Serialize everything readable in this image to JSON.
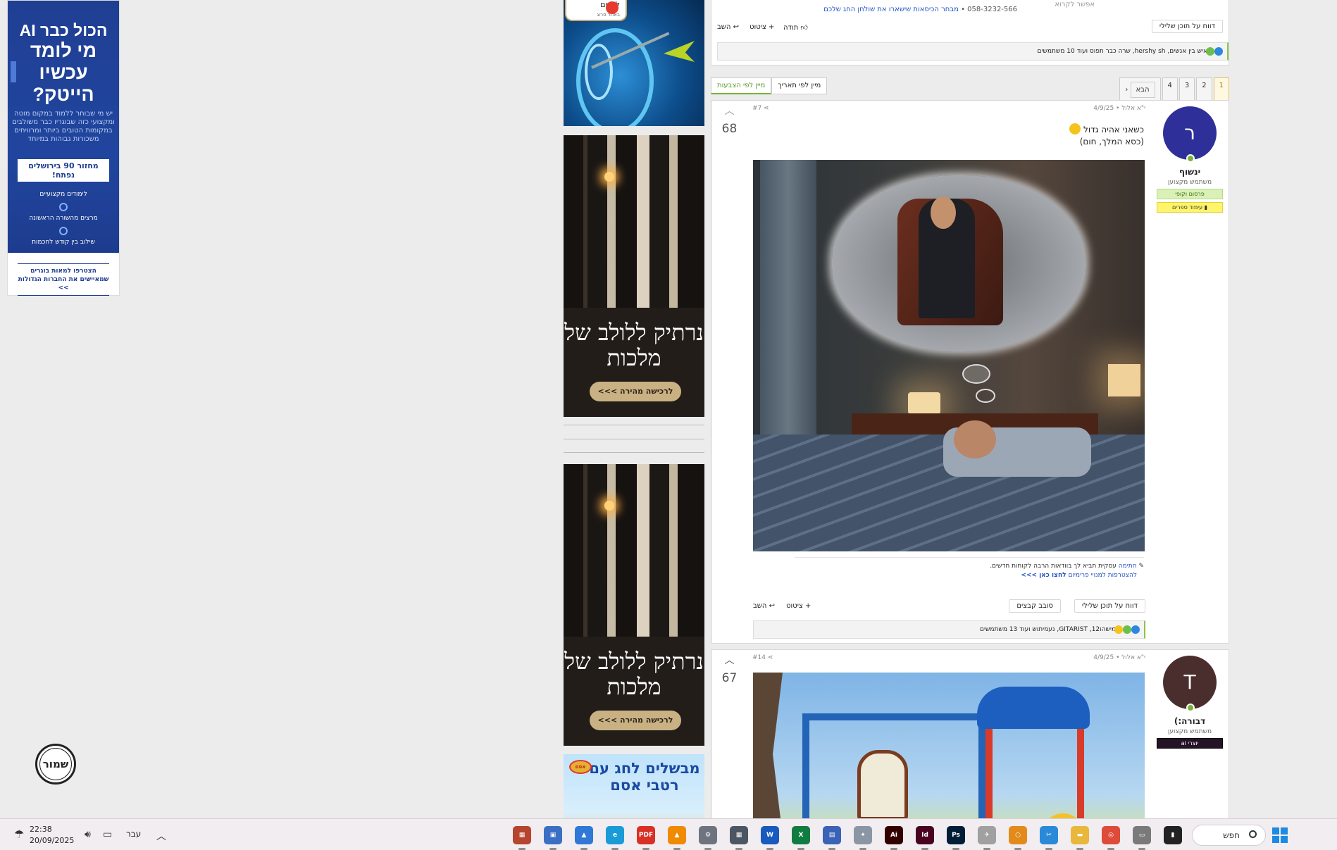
{
  "left_ad": {
    "headline1": "הכול כבר AI",
    "headline2": "מי לומד עכשיו הייטק?",
    "body": "יש מי שבוחר ללמוד במקום מוטה ומקצועי כזה שבוגריו כבר משולבים במקומות הטובים ביותר ומרוויחים משכורות גבוהות במיוחד",
    "cta": "מחזור 90 בירושלים נפתח!",
    "features": [
      "לימודים מקצועיים",
      "מרצים מהשורה הראשונה",
      "שילוב בין קודש לחכמות"
    ],
    "bottom_line1": "הצטרפו למאות בוגרים",
    "bottom_line2": "שמאיישים את החברות הגדולות >>",
    "accent": "#1f3f93"
  },
  "stamp_logo": {
    "text": "שמור"
  },
  "mid_ads": {
    "top_badge_title": "לחגים",
    "top_badge_sub": "באתר פרוג",
    "book_title": "נרתיק ללולב של מלכות",
    "book_button": "לרכישה מהירה >>>",
    "food_title": "מבשלים לחג עם רטבי אסם",
    "food_brand": "אסם"
  },
  "prev_post": {
    "sig_top": "אפשר לקרוא",
    "sig_phone": "058-3232-566 •",
    "sig_link": "מבחר הכיסאות שישארו את שולחן החג שלכם",
    "report_btn": "דווח על תוכן שלילי",
    "like_label": "תודה",
    "quote_label": "ציטוט",
    "reply_label": "השב",
    "reactions_text": "איש בין אנשים, hershy sh, שרה כבר תפוס ועוד 10 משתמשים"
  },
  "pager": {
    "pages": [
      "1",
      "2",
      "3",
      "4"
    ],
    "current": "1",
    "next_label": "הבא"
  },
  "sort": {
    "by_date": "מיין לפי תאריך",
    "by_votes": "מיין לפי הצבעות",
    "active": "by_votes"
  },
  "post7": {
    "number": "#7",
    "date": "י\"א אלול • 4/9/25",
    "username": "ינשוף",
    "avatar_letter": "ר",
    "avatar_color": "#2f2f9a",
    "role": "משתמש מקצוען",
    "badge1": "פרסום וקופי",
    "badge2": "עימוד ספרים",
    "score": "68",
    "line1": "כשאני אהיה גדול",
    "line2": "(כסא המלך, חום)",
    "sig_prefix": "חתימה",
    "sig_text": "עסקית תביא לך בוודאות הרבה לקוחות חדשים.",
    "sig_line2": "להצטרפות למנויי פרימיום",
    "sig_link": "לחצו כאן >>>",
    "report_btn": "דווח על תוכן שלילי",
    "files_btn": "סובב קבצים",
    "quote_label": "ציטוט",
    "reply_label": "השב",
    "reactions_text": "מישהו12, GITARIST, נעמיתוש ועוד 13 משתמשים"
  },
  "post14": {
    "number": "#14",
    "date": "י\"א אלול • 4/9/25",
    "username": "דבורה:)",
    "avatar_letter": "T",
    "avatar_color": "#4a2e2e",
    "role": "משתמש מקצוען",
    "badge1": "יוצרי ai",
    "score": "67"
  },
  "taskbar": {
    "search_label": "חפש",
    "time": "22:38",
    "date": "20/09/2025",
    "lang": "עבר",
    "apps": [
      {
        "name": "winrar-icon",
        "color": "#b5452f",
        "glyph": "▦"
      },
      {
        "name": "app-blue-icon",
        "color": "#3b6fc4",
        "glyph": "▣"
      },
      {
        "name": "photos-icon",
        "color": "#2f78d6",
        "glyph": "▲"
      },
      {
        "name": "edge-icon",
        "color": "#1a9bd8",
        "glyph": "e"
      },
      {
        "name": "pdf-icon",
        "color": "#d93025",
        "glyph": "PDF"
      },
      {
        "name": "vlc-icon",
        "color": "#f08a00",
        "glyph": "▲"
      },
      {
        "name": "settings-icon",
        "color": "#6d7480",
        "glyph": "⚙"
      },
      {
        "name": "calculator-icon",
        "color": "#4b5563",
        "glyph": "▦"
      },
      {
        "name": "word-icon",
        "color": "#185abd",
        "glyph": "W"
      },
      {
        "name": "excel-icon",
        "color": "#107c41",
        "glyph": "X"
      },
      {
        "name": "app-tiles-icon",
        "color": "#3a62b7",
        "glyph": "▤"
      },
      {
        "name": "tool-icon",
        "color": "#8b96a5",
        "glyph": "✦"
      },
      {
        "name": "illustrator-icon",
        "color": "#330000",
        "glyph": "Ai"
      },
      {
        "name": "indesign-icon",
        "color": "#49021f",
        "glyph": "Id"
      },
      {
        "name": "photoshop-icon",
        "color": "#001e36",
        "glyph": "Ps"
      },
      {
        "name": "pcfx-icon",
        "color": "#a0a0a0",
        "glyph": "✈"
      },
      {
        "name": "search-app-icon",
        "color": "#e38a1c",
        "glyph": "○"
      },
      {
        "name": "snipping-icon",
        "color": "#2b8ad8",
        "glyph": "✂"
      },
      {
        "name": "file-explorer-icon",
        "color": "#e8b73b",
        "glyph": "▬"
      },
      {
        "name": "chrome-icon",
        "color": "#de4b39",
        "glyph": "◎"
      },
      {
        "name": "app-window-icon",
        "color": "#7a7a7a",
        "glyph": "▭"
      },
      {
        "name": "app-dark-icon",
        "color": "#222222",
        "glyph": "▮"
      }
    ]
  }
}
